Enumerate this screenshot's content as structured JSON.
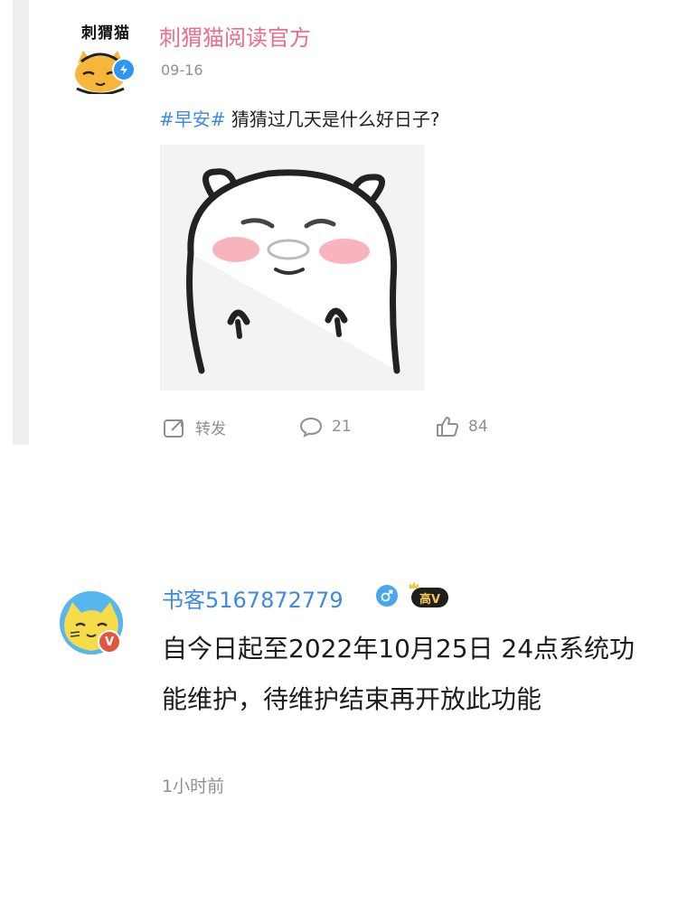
{
  "post": {
    "logo_text": "刺猬猫",
    "account_name": "刺猬猫阅读官方",
    "date": "09-16",
    "topic": "#早安#",
    "text": "猜猜过几天是什么好日子?",
    "actions": {
      "repost_label": "转发",
      "comment_count": "21",
      "like_count": "84"
    }
  },
  "comment": {
    "user_name": "书客5167872779",
    "level_label": "高V",
    "avatar_badge": "V",
    "text": "自今日起至2022年10月25日 24点系统功能维护，待维护结束再开放此功能",
    "time": "1小时前"
  },
  "colors": {
    "account_name": "#ec6d8a",
    "link_blue": "#3c8be0",
    "meta_gray": "#8f8f8f",
    "verify_blue": "#2f95f3",
    "badge_red": "#e2563d"
  }
}
